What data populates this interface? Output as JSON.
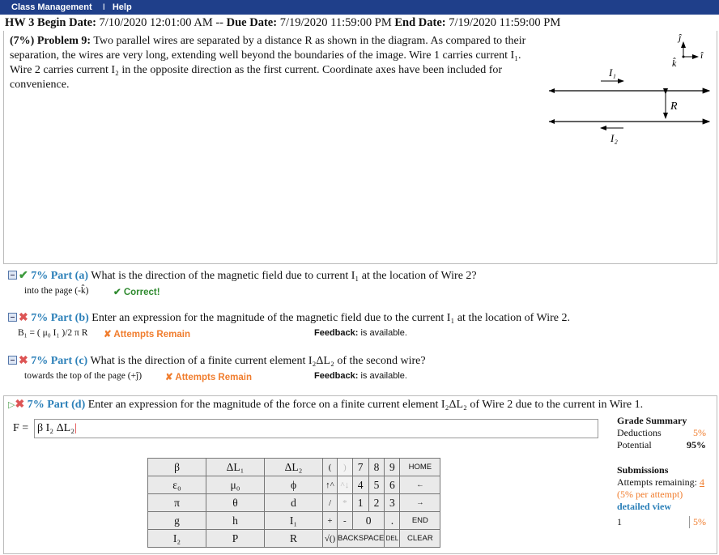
{
  "topbar": {
    "class_mgmt": "Class Management",
    "sep": "I",
    "help": "Help"
  },
  "hw": {
    "title": "HW 3",
    "begin_label": "Begin Date:",
    "begin": "7/10/2020 12:01:00 AM --",
    "due_label": "Due Date:",
    "due": "7/19/2020 11:59:00 PM",
    "end_label": "End Date:",
    "end": "7/19/2020 11:59:00 PM"
  },
  "problem": {
    "weight": "(7%)",
    "label": "Problem 9:",
    "text": "Two parallel wires are separated by a distance R as shown in the diagram. As compared to their separation, the wires are very long, extending well beyond the boundaries of the image. Wire 1 carries current I₁. Wire 2 carries current I₂ in the opposite direction as the first current. Coordinate axes have been included for convenience."
  },
  "diagram": {
    "j": "ĵ",
    "i": "î",
    "k": "k̂",
    "I1": "I₁",
    "I2": "I₂",
    "R": "R"
  },
  "parts": {
    "a": {
      "title": "7% Part (a)",
      "question": "What is the direction of the magnetic field due to current I₁ at the location of Wire 2?",
      "answer": "into the page (-k̂)",
      "status": "✔ Correct!"
    },
    "b": {
      "title": "7% Part (b)",
      "question": "Enter an expression for the magnitude of the magnetic field due to the current I₁ at the location of Wire 2.",
      "answer": "B₁ = ( μ₀ I₁ )/2 π R",
      "status": "✘ Attempts Remain",
      "feedback_label": "Feedback:",
      "feedback": "is available."
    },
    "c": {
      "title": "7% Part (c)",
      "question": "What is the direction of a finite current element I₂ΔL₂ of the second wire?",
      "answer": "towards the top of the page (+ĵ)",
      "status": "✘ Attempts Remain",
      "feedback_label": "Feedback:",
      "feedback": "is available."
    },
    "d": {
      "title": "7% Part (d)",
      "question": "Enter an expression for the magnitude of the force on a finite current element I₂ΔL₂ of Wire 2 due to the current in Wire 1."
    }
  },
  "input": {
    "label": "F =",
    "value": "β I₂ ΔL₂"
  },
  "keypad": {
    "rows": [
      [
        "β",
        "ΔL₁",
        "ΔL₂",
        "(",
        ")",
        "7",
        "8",
        "9",
        "HOME"
      ],
      [
        "ε₀",
        "μ₀",
        "ϕ",
        "↑^",
        "^↓",
        "4",
        "5",
        "6",
        "←"
      ],
      [
        "π",
        "θ",
        "d",
        "/",
        "*",
        "1",
        "2",
        "3",
        "→"
      ],
      [
        "g",
        "h",
        "I₁",
        "+",
        "-",
        "0",
        ".",
        "",
        "END"
      ],
      [
        "I₂",
        "P",
        "R",
        "√()",
        "BACKSPACE",
        "DEL",
        "CLEAR"
      ]
    ]
  },
  "grade": {
    "title": "Grade Summary",
    "deductions_label": "Deductions",
    "deductions": "5%",
    "potential_label": "Potential",
    "potential": "95%",
    "submissions_title": "Submissions",
    "attempts_label": "Attempts remaining:",
    "attempts": "4",
    "per_attempt": "(5% per attempt)",
    "detailed": "detailed view",
    "sub_num": "1",
    "sub_pct": "5%"
  },
  "colors": {
    "topbar": "#1f3f8a",
    "part_title": "#2a7fb8",
    "orange": "#f07d2e",
    "green": "#2f8a2f"
  }
}
